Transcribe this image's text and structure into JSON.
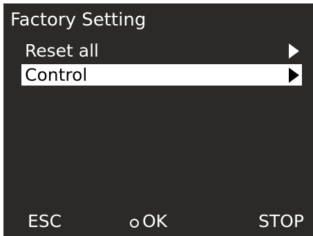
{
  "screen": {
    "title": "Factory Setting",
    "background": "#2b2a28",
    "highlight": "#ffffff"
  },
  "menu": {
    "items": [
      {
        "label": "Reset all",
        "selected": false,
        "icon": "arrow-right-icon"
      },
      {
        "label": "Control",
        "selected": true,
        "icon": "arrow-right-icon"
      }
    ]
  },
  "softkeys": {
    "esc_label": "ESC",
    "ok_label": "OK",
    "ok_icon": "ring-icon",
    "stop_label": "STOP"
  }
}
